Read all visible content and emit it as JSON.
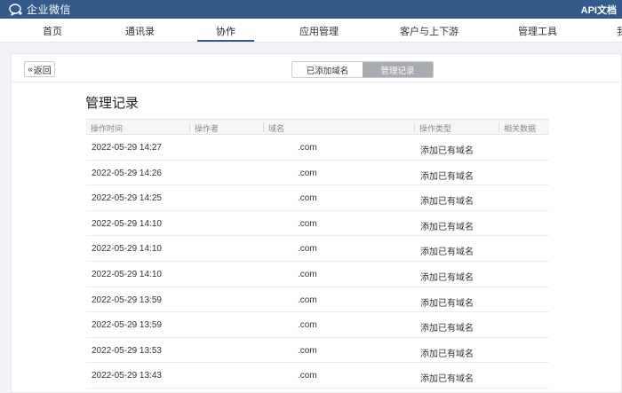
{
  "app": {
    "title": "企业微信",
    "api_link": "API文档"
  },
  "nav": {
    "items": [
      {
        "label": "首页"
      },
      {
        "label": "通讯录"
      },
      {
        "label": "协作"
      },
      {
        "label": "应用管理"
      },
      {
        "label": "客户与上下游"
      },
      {
        "label": "管理工具"
      },
      {
        "label": "我"
      }
    ],
    "active_index": 2
  },
  "subheader": {
    "back_label": "返回",
    "segments": [
      {
        "label": "已添加域名"
      },
      {
        "label": "管理记录"
      }
    ],
    "active_segment": 1
  },
  "page": {
    "title": "管理记录"
  },
  "table": {
    "columns": [
      "操作时间",
      "操作者",
      "域名",
      "操作类型",
      "相关数据"
    ],
    "rows": [
      {
        "time": "2022-05-29 14:27",
        "operator": "",
        "domain": ".com",
        "type": "添加已有域名",
        "related": ""
      },
      {
        "time": "2022-05-29 14:26",
        "operator": "",
        "domain": ".com",
        "type": "添加已有域名",
        "related": ""
      },
      {
        "time": "2022-05-29 14:25",
        "operator": "",
        "domain": ".com",
        "type": "添加已有域名",
        "related": ""
      },
      {
        "time": "2022-05-29 14:10",
        "operator": "",
        "domain": ".com",
        "type": "添加已有域名",
        "related": ""
      },
      {
        "time": "2022-05-29 14:10",
        "operator": "",
        "domain": ".com",
        "type": "添加已有域名",
        "related": ""
      },
      {
        "time": "2022-05-29 14:10",
        "operator": "",
        "domain": ".com",
        "type": "添加已有域名",
        "related": ""
      },
      {
        "time": "2022-05-29 13:59",
        "operator": "",
        "domain": ".com",
        "type": "添加已有域名",
        "related": ""
      },
      {
        "time": "2022-05-29 13:59",
        "operator": "",
        "domain": ".com",
        "type": "添加已有域名",
        "related": ""
      },
      {
        "time": "2022-05-29 13:53",
        "operator": "",
        "domain": ".com",
        "type": "添加已有域名",
        "related": ""
      },
      {
        "time": "2022-05-29 13:43",
        "operator": "",
        "domain": ".com",
        "type": "添加已有域名",
        "related": ""
      }
    ]
  },
  "colors": {
    "topbar": "#345a8b",
    "active_segment": "#a8abb0"
  }
}
